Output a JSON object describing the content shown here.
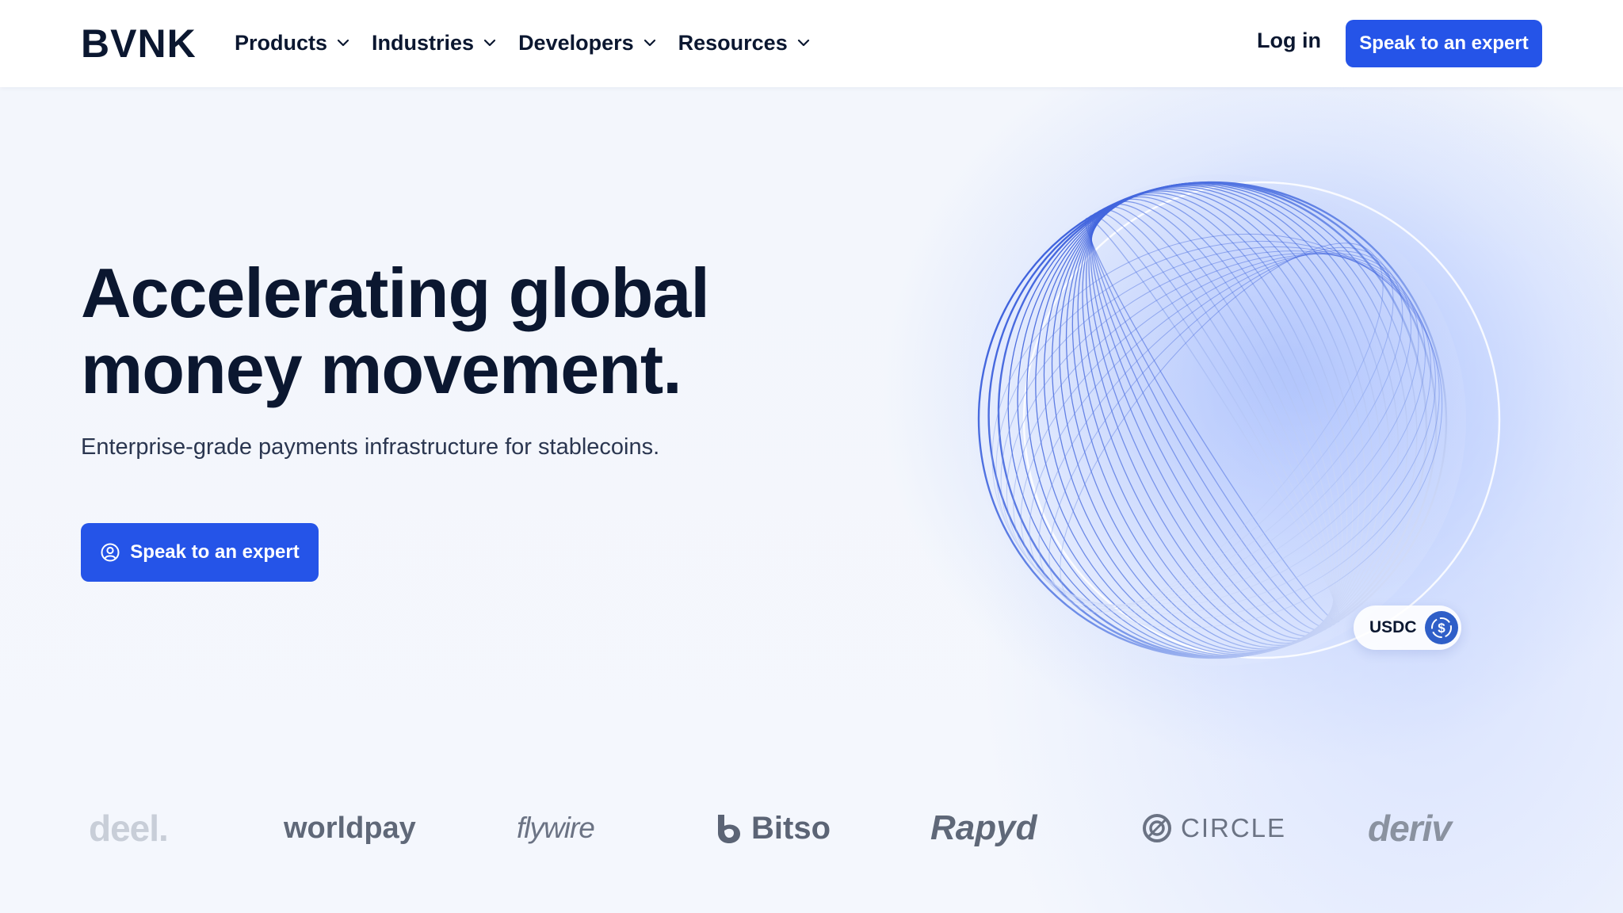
{
  "nav": {
    "logo": "BVNK",
    "menu": [
      {
        "label": "Products"
      },
      {
        "label": "Industries"
      },
      {
        "label": "Developers"
      },
      {
        "label": "Resources"
      }
    ],
    "login": "Log in",
    "cta": "Speak to an expert"
  },
  "hero": {
    "title_line1": "Accelerating global",
    "title_line2": "money movement.",
    "subtitle": "Enterprise-grade payments infrastructure for stablecoins.",
    "cta": "Speak to an expert",
    "badge": "USDC"
  },
  "partners": [
    "deel.",
    "worldpay",
    "flywire",
    "Bitso",
    "Rapyd",
    "CIRCLE",
    "deriv"
  ],
  "colors": {
    "accent": "#2554e8",
    "text": "#0b1730"
  }
}
